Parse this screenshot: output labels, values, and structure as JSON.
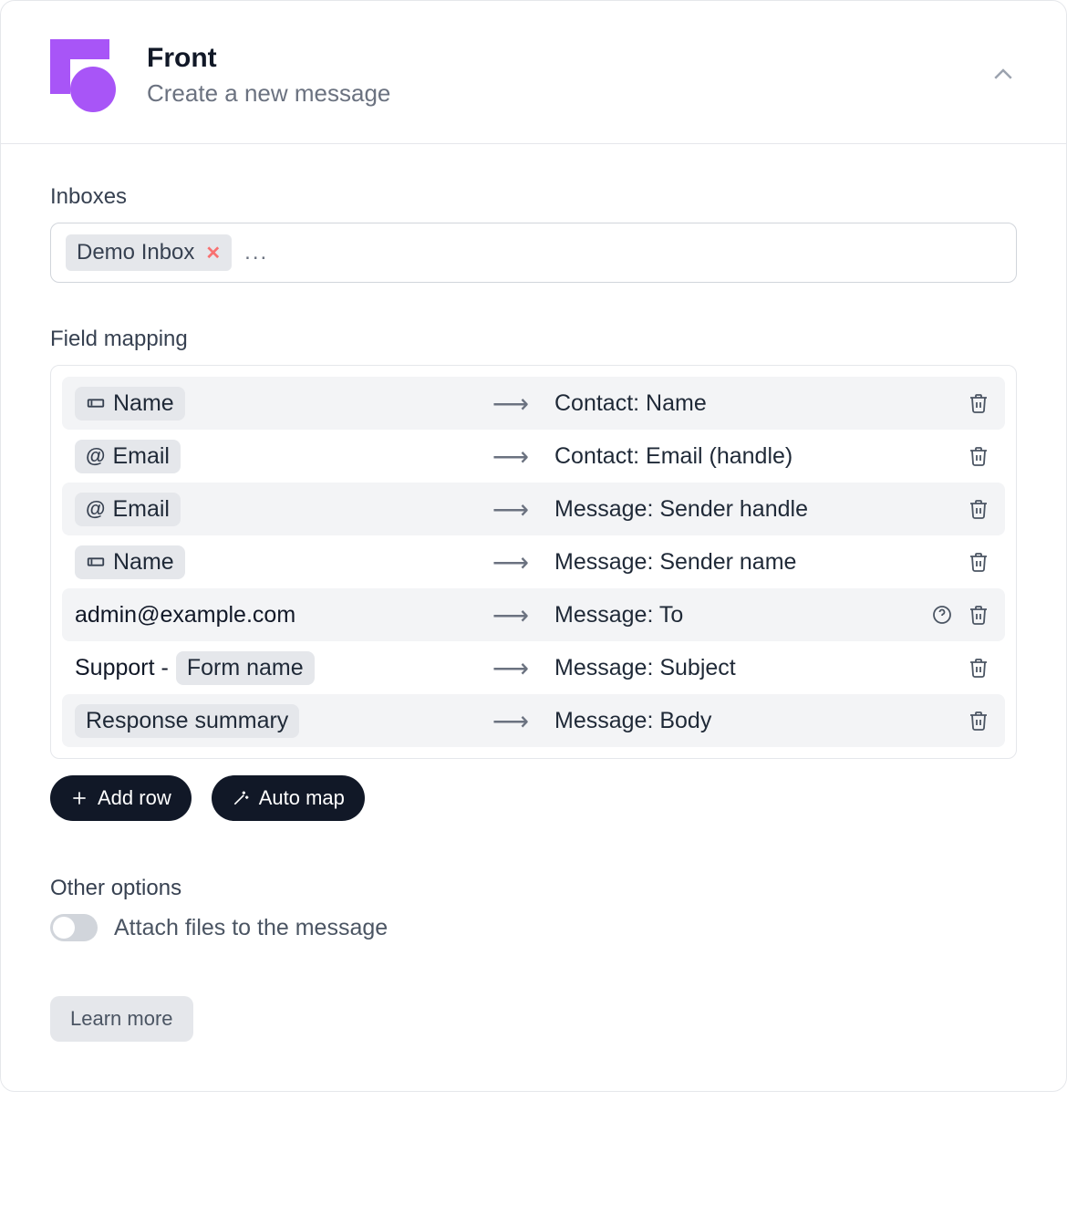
{
  "header": {
    "app_title": "Front",
    "app_subtitle": "Create a new message"
  },
  "inboxes": {
    "label": "Inboxes",
    "tokens": [
      {
        "label": "Demo Inbox"
      }
    ],
    "more_indicator": "..."
  },
  "field_mapping": {
    "label": "Field mapping",
    "rows": [
      {
        "left_type": "chip",
        "left_icon": "field",
        "left_text": "Name",
        "right_text": "Contact: Name",
        "has_help": false
      },
      {
        "left_type": "chip",
        "left_icon": "at",
        "left_text": "Email",
        "right_text": "Contact: Email (handle)",
        "has_help": false
      },
      {
        "left_type": "chip",
        "left_icon": "at",
        "left_text": "Email",
        "right_text": "Message: Sender handle",
        "has_help": false
      },
      {
        "left_type": "chip",
        "left_icon": "field",
        "left_text": "Name",
        "right_text": "Message: Sender name",
        "has_help": false
      },
      {
        "left_type": "plain",
        "left_text": "admin@example.com",
        "right_text": "Message: To",
        "has_help": true
      },
      {
        "left_type": "mixed",
        "left_prefix": "Support - ",
        "left_chip_text": "Form name",
        "right_text": "Message: Subject",
        "has_help": false
      },
      {
        "left_type": "chip",
        "left_icon": "none",
        "left_text": "Response summary",
        "right_text": "Message: Body",
        "has_help": false
      }
    ],
    "add_row_label": "Add row",
    "auto_map_label": "Auto map"
  },
  "other_options": {
    "label": "Other options",
    "toggle_label": "Attach files to the message",
    "toggle_on": false
  },
  "learn_more_label": "Learn more",
  "icons": {
    "arrow": "⟶"
  }
}
